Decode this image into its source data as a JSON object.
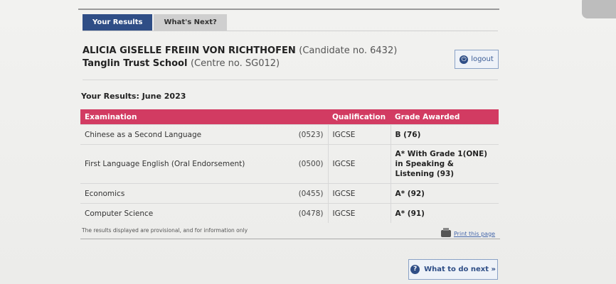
{
  "tabs": [
    {
      "label": "Your Results",
      "active": true
    },
    {
      "label": "What's Next?",
      "active": false
    }
  ],
  "candidate": {
    "name": "ALICIA GISELLE FREIIN VON RICHTHOFEN",
    "number_text": "(Candidate no. 6432)",
    "school": "Tanglin Trust School",
    "centre_text": "(Centre no. SG012)"
  },
  "logout_label": "logout",
  "results_title": "Your Results: June 2023",
  "table": {
    "headers": {
      "examination": "Examination",
      "qualification": "Qualification",
      "grade": "Grade Awarded"
    },
    "rows": [
      {
        "subject": "Chinese as a Second Language",
        "code": "(0523)",
        "qualification": "IGCSE",
        "grade": "B (76)"
      },
      {
        "subject": "First Language English (Oral Endorsement)",
        "code": "(0500)",
        "qualification": "IGCSE",
        "grade": "A* With Grade 1(ONE) in Speaking & Listening (93)"
      },
      {
        "subject": "Economics",
        "code": "(0455)",
        "qualification": "IGCSE",
        "grade": "A* (92)"
      },
      {
        "subject": "Computer Science",
        "code": "(0478)",
        "qualification": "IGCSE",
        "grade": "A* (91)"
      }
    ]
  },
  "footnote": "The results displayed are provisional, and for information only",
  "print_label": "Print this page",
  "next_button_label": "What to do next »",
  "colors": {
    "tab_active": "#2f4e86",
    "header_pink": "#d23b62",
    "link_blue": "#4466aa"
  }
}
